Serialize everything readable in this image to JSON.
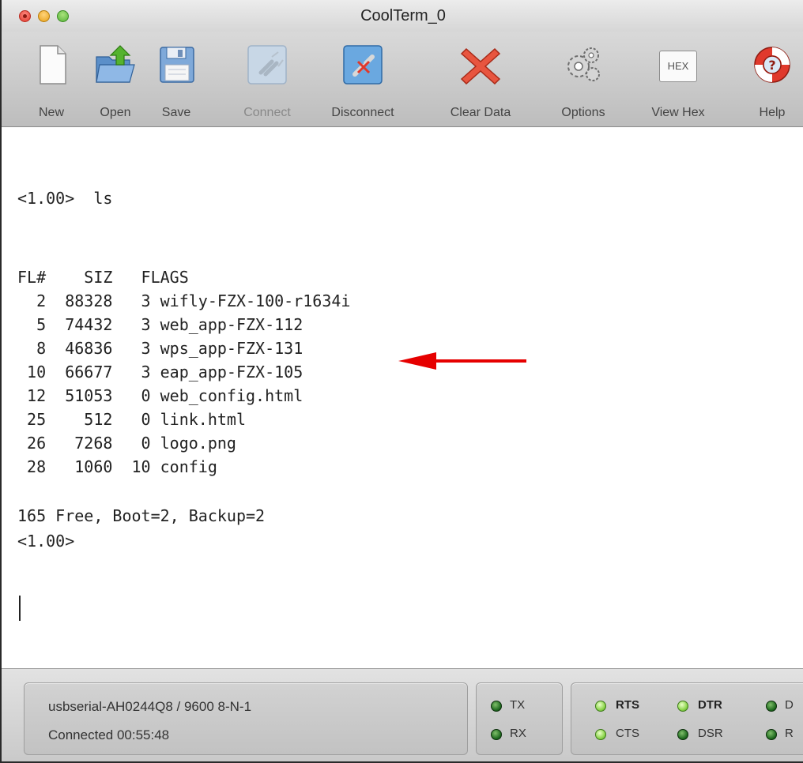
{
  "window": {
    "title": "CoolTerm_0"
  },
  "toolbar": {
    "buttons": [
      {
        "label": "New",
        "icon": "new-document-icon",
        "enabled": true
      },
      {
        "label": "Open",
        "icon": "open-folder-icon",
        "enabled": true
      },
      {
        "label": "Save",
        "icon": "save-disk-icon",
        "enabled": true
      },
      {
        "label": "Connect",
        "icon": "connect-plug-icon",
        "enabled": false
      },
      {
        "label": "Disconnect",
        "icon": "disconnect-plug-icon",
        "enabled": true
      },
      {
        "label": "Clear Data",
        "icon": "clear-x-icon",
        "enabled": true
      },
      {
        "label": "Options",
        "icon": "gears-icon",
        "enabled": true
      },
      {
        "label": "View Hex",
        "icon": "hex-icon",
        "enabled": true,
        "icon_text": "HEX"
      },
      {
        "label": "Help",
        "icon": "lifebuoy-help-icon",
        "enabled": true
      }
    ]
  },
  "terminal": {
    "prompt_cmd": "<1.00>  ls",
    "header": "FL#    SIZ   FLAGS",
    "rows": [
      "  2  88328   3 wifly-FZX-100-r1634i",
      "  5  74432   3 web_app-FZX-112",
      "  8  46836   3 wps_app-FZX-131",
      " 10  66677   3 eap_app-FZX-105",
      " 12  51053   0 web_config.html",
      " 25    512   0 link.html",
      " 26   7268   0 logo.png",
      " 28   1060  10 config"
    ],
    "summary": "165 Free, Boot=2, Backup=2",
    "prompt_end": "<1.00>",
    "arrow_color": "#e60000"
  },
  "status": {
    "port": "usbserial-AH0244Q8 / 9600 8-N-1",
    "connection": "Connected 00:55:48",
    "tx": "TX",
    "rx": "RX",
    "rts": "RTS",
    "cts": "CTS",
    "dtr": "DTR",
    "dsr": "DSR",
    "dcd": "D",
    "ri": "R"
  }
}
